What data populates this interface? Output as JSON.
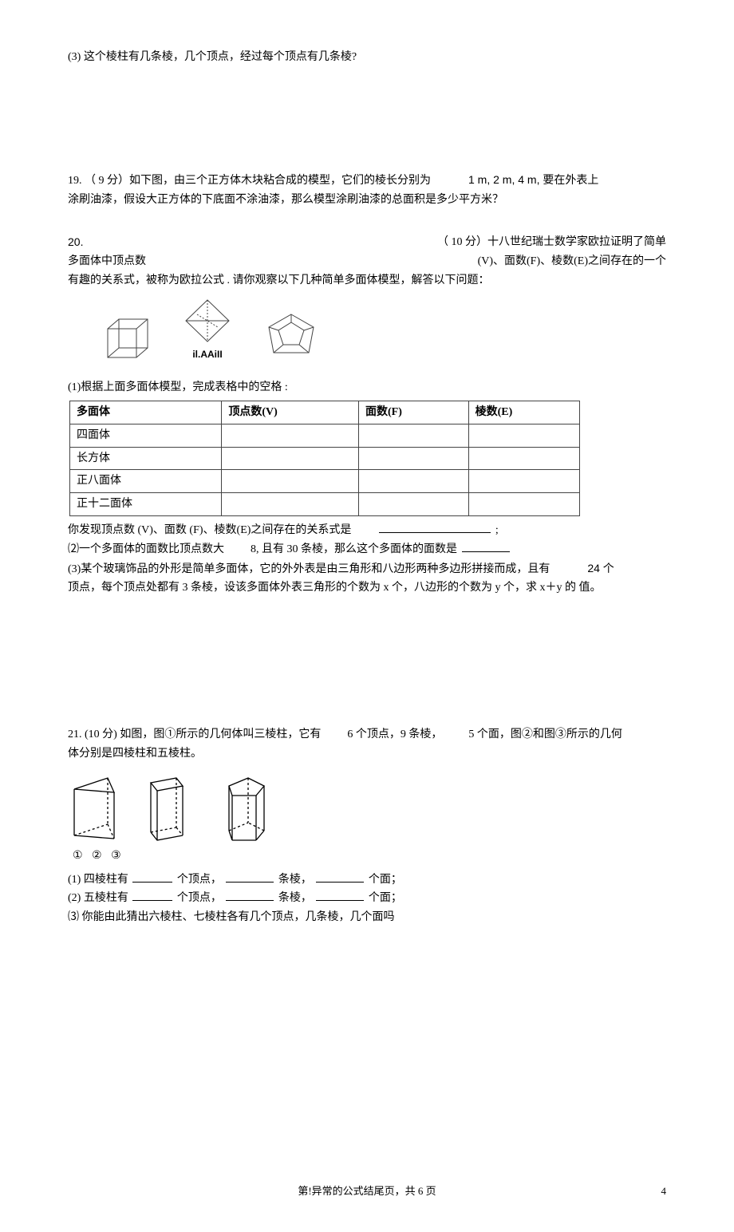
{
  "q18_part3": "(3) 这个棱柱有几条棱，几个顶点，经过每个顶点有几条棱?",
  "q19": {
    "prefix": "19.  （ 9 分）如下图，由三个正方体木块粘合成的模型，它们的棱长分别为",
    "dims": "1 m,  2 m,  4 m, 要在外表上",
    "line2": "涂刷油漆，假设大正方体的下底面不涂油漆，那么模型涂刷油漆的总面积是多少平方米？"
  },
  "q20": {
    "label": "20.",
    "right1": "（ 10 分）十八世纪瑞士数学家欧拉证明了简单",
    "left2": "多面体中顶点数",
    "right2": "(V)、面数(F)、棱数(E)之间存在的一个",
    "line3": "有趣的关系式，被称为欧拉公式 . 请你观察以下几种简单多面体模型，解答以下问题：",
    "caption": "il.AAiII",
    "part1_intro": "(1)根据上面多面体模型，完成表格中的空格 :",
    "table": {
      "headers": [
        "多面体",
        "顶点数(V)",
        "面数(F)",
        "棱数(E)"
      ],
      "rows": [
        "四面体",
        "长方体",
        "正八面体",
        "正十二面体"
      ]
    },
    "relation_prefix": "你发现顶点数 (V)、面数 (F)、棱数(E)之间存在的关系式是",
    "relation_suffix": ";",
    "part2_a": "⑵一个多面体的面数比顶点数大",
    "part2_b": "8, 且有 30 条棱，那么这个多面体的面数是",
    "part3_a": "(3)某个玻璃饰品的外形是简单多面体，它的外外表是由三角形和八边形两种多边形拼接而成，且有",
    "part3_b": "24 个",
    "part3_c": "顶点，每个顶点处都有 3 条棱，设该多面体外表三角形的个数为 x 个，八边形的个数为 y 个，求 x＋y 的  值。"
  },
  "q21": {
    "line1_a": "21.  (10 分) 如图，图①所示的几何体叫三棱柱，它有",
    "line1_b": "6 个顶点，9 条棱，",
    "line1_c": "5 个面，图②和图③所示的几何",
    "line2": "体分别是四棱柱和五棱柱。",
    "labels": "①  ②  ③",
    "p1_a": "(1)  四棱柱有",
    "p1_b": "个顶点，",
    "p1_c": "条棱，",
    "p1_d": "个面；",
    "p2_a": "(2)  五棱柱有",
    "p2_b": "个顶点，",
    "p2_c": "条棱，",
    "p2_d": "个面；",
    "p3": "⑶  你能由此猜出六棱柱、七棱柱各有几个顶点，几条棱，几个面吗"
  },
  "footer": {
    "center": "第!异常的公式结尾页，共 6 页",
    "right": "4"
  }
}
